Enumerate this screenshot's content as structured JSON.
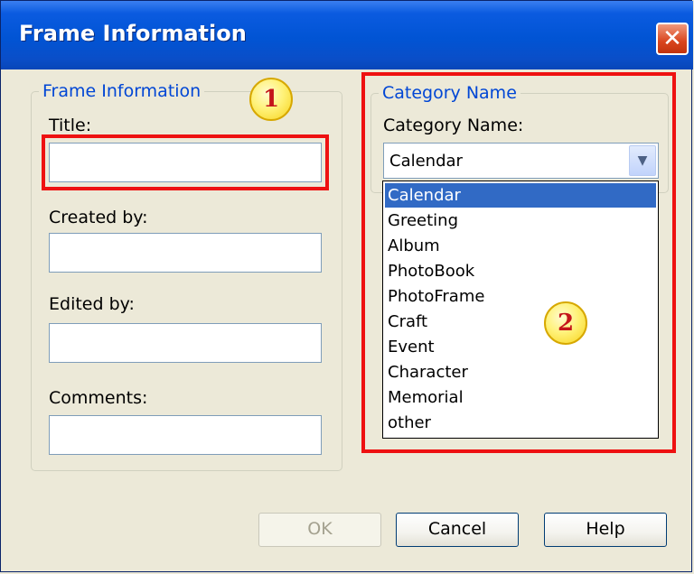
{
  "window": {
    "title": "Frame Information"
  },
  "frame_info": {
    "legend": "Frame Information",
    "title_label": "Title:",
    "title_value": "",
    "created_label": "Created by:",
    "created_value": "",
    "edited_label": "Edited by:",
    "edited_value": "",
    "comments_label": "Comments:",
    "comments_value": ""
  },
  "category": {
    "legend": "Category Name",
    "label": "Category Name:",
    "selected": "Calendar",
    "options": [
      "Calendar",
      "Greeting",
      "Album",
      "PhotoBook",
      "PhotoFrame",
      "Craft",
      "Event",
      "Character",
      "Memorial",
      "other"
    ]
  },
  "annotations": {
    "badge1": "1",
    "badge2": "2"
  },
  "buttons": {
    "ok": "OK",
    "cancel": "Cancel",
    "help": "Help"
  },
  "icons": {
    "close": "close-icon",
    "dropdown": "chevron-down-icon"
  },
  "colors": {
    "highlight": "#ee1111",
    "title_bar": "#0154d4",
    "selection": "#316ac5",
    "legend": "#0046d5"
  }
}
